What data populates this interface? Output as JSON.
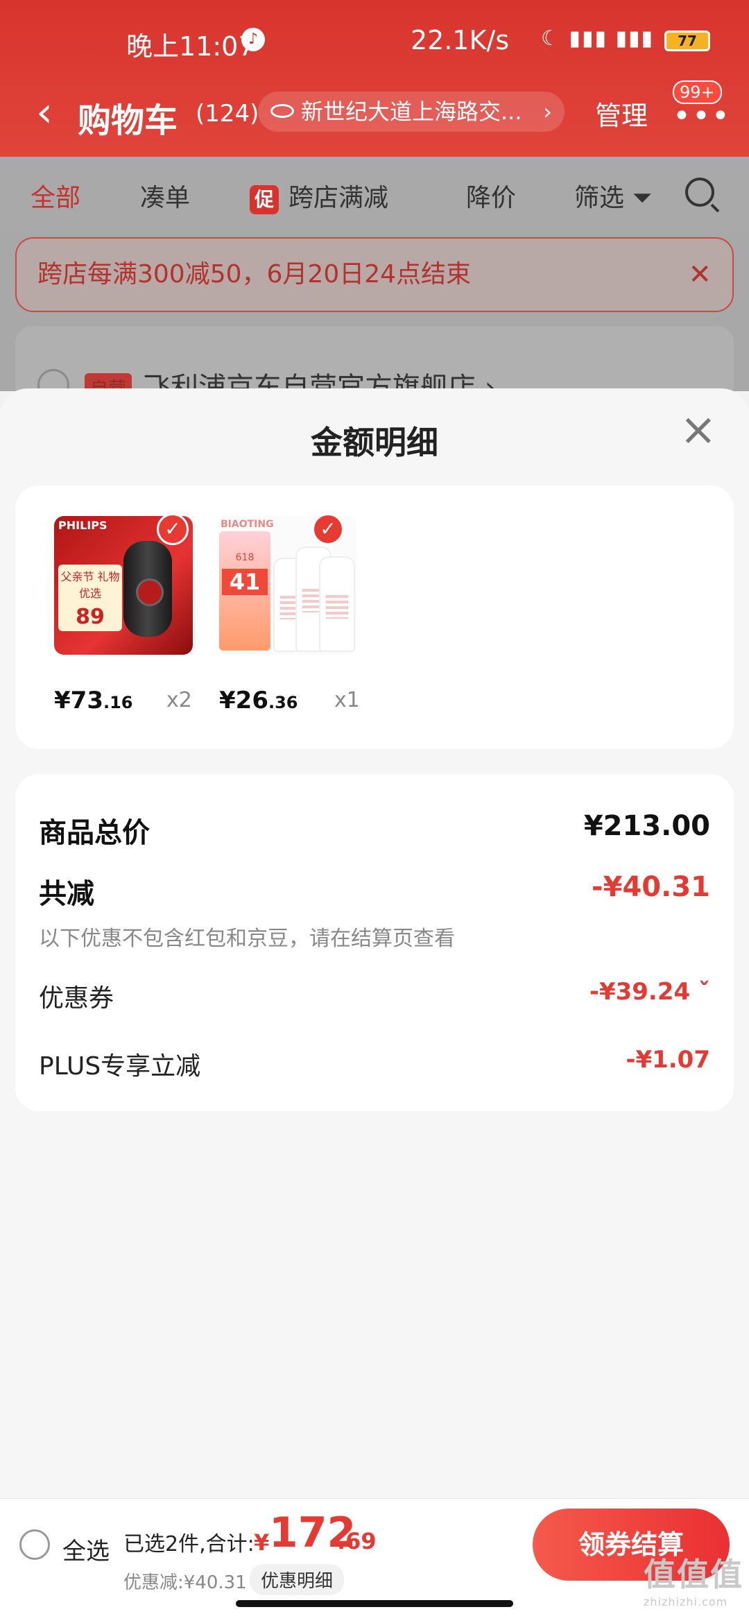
{
  "status_bar": {
    "time": "晚上11:07",
    "speed": "22.1K/s",
    "battery": "77"
  },
  "nav": {
    "back": "‹",
    "title": "购物车",
    "count": "(124)",
    "address": "新世纪大道上海路交...",
    "manage": "管理",
    "badge": "99+"
  },
  "tabs": [
    "全部",
    "凑单",
    "跨店满减",
    "降价",
    "筛选"
  ],
  "promo_icon_label": "促",
  "banner": {
    "text": "跨店每满300减50，6月20日24点结束"
  },
  "store": {
    "tag": "自营",
    "name": "飞利浦京东自营官方旗舰店 ›"
  },
  "sheet": {
    "title": "金额明细",
    "products": [
      {
        "brand": "PHILIPS",
        "promo_line": "父亲节 礼物优选",
        "promo_price": "89",
        "price_int": "¥73",
        "price_dec": ".16",
        "qty": "x2"
      },
      {
        "brand": "BIAOTING",
        "promo_line": "618",
        "promo_price": "41",
        "price_int": "¥26",
        "price_dec": ".36",
        "qty": "x1"
      }
    ],
    "summary": {
      "total_label": "商品总价",
      "total_value": "¥213.00",
      "reduce_label": "共减",
      "reduce_value": "-¥40.31",
      "note": "以下优惠不包含红包和京豆，请在结算页查看",
      "coupon_label": "优惠券",
      "coupon_value": "-¥39.24 ˇ",
      "plus_label": "PLUS专享立减",
      "plus_value": "-¥1.07"
    }
  },
  "footer": {
    "select_all": "全选",
    "selected": "已选2件,合计:",
    "currency": "¥",
    "total_int": "172",
    "total_dec": ".69",
    "discount": "优惠减:¥40.31",
    "detail": "优惠明细",
    "checkout": "领券结算"
  },
  "watermark": {
    "text": "值值值",
    "sub": "zhizhizhi.com"
  },
  "colors": {
    "brand_red": "#e33b33",
    "header_red": "#d8342e"
  }
}
